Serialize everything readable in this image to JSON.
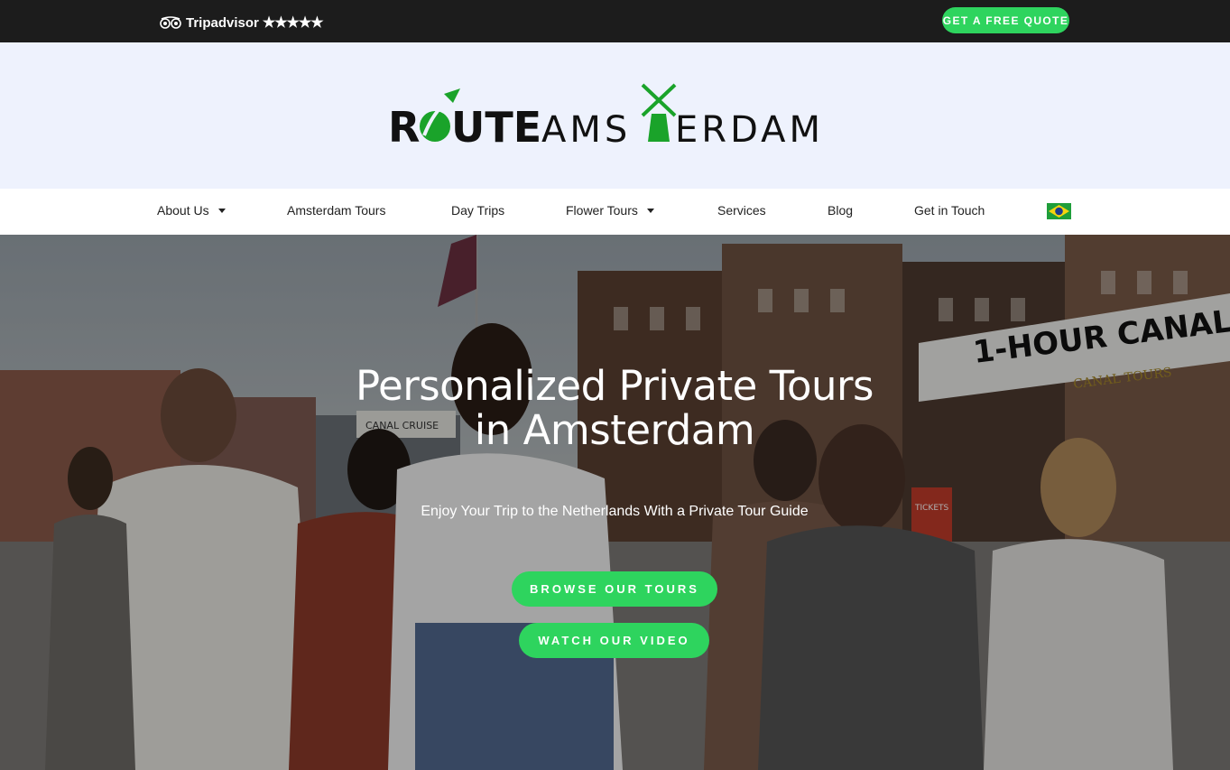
{
  "topbar": {
    "tripadvisor_label": "Tripadvisor",
    "rating_stars": "★★★★★",
    "quote_button": "GET A FREE QUOTE"
  },
  "logo": {
    "brand_left": "ROUTE",
    "brand_right": "AMSTERDAM"
  },
  "nav": {
    "items": [
      {
        "label": "About Us",
        "dropdown": true
      },
      {
        "label": "Amsterdam Tours",
        "dropdown": false
      },
      {
        "label": "Day Trips",
        "dropdown": false
      },
      {
        "label": "Flower Tours",
        "dropdown": true
      },
      {
        "label": "Services",
        "dropdown": false
      },
      {
        "label": "Blog",
        "dropdown": false
      },
      {
        "label": "Get in Touch",
        "dropdown": false
      }
    ],
    "language_flag": "brazil-flag-icon"
  },
  "hero": {
    "title_line1": "Personalized Private Tours",
    "title_line2": "in Amsterdam",
    "subtitle": "Enjoy Your Trip to the Netherlands With a Private Tour Guide",
    "browse_button": "BROWSE OUR TOURS",
    "video_button": "WATCH OUR VIDEO",
    "sign_text": "1-HOUR CANAL",
    "sign_subtext": "CANAL TOURS",
    "cruise_text": "CANAL CRUISE",
    "tickets_text": "TICKETS"
  },
  "colors": {
    "accent_green": "#2ed45e",
    "logo_green": "#1aa32a",
    "topbar": "#1c1c1c",
    "logo_band": "#eef2fd"
  }
}
